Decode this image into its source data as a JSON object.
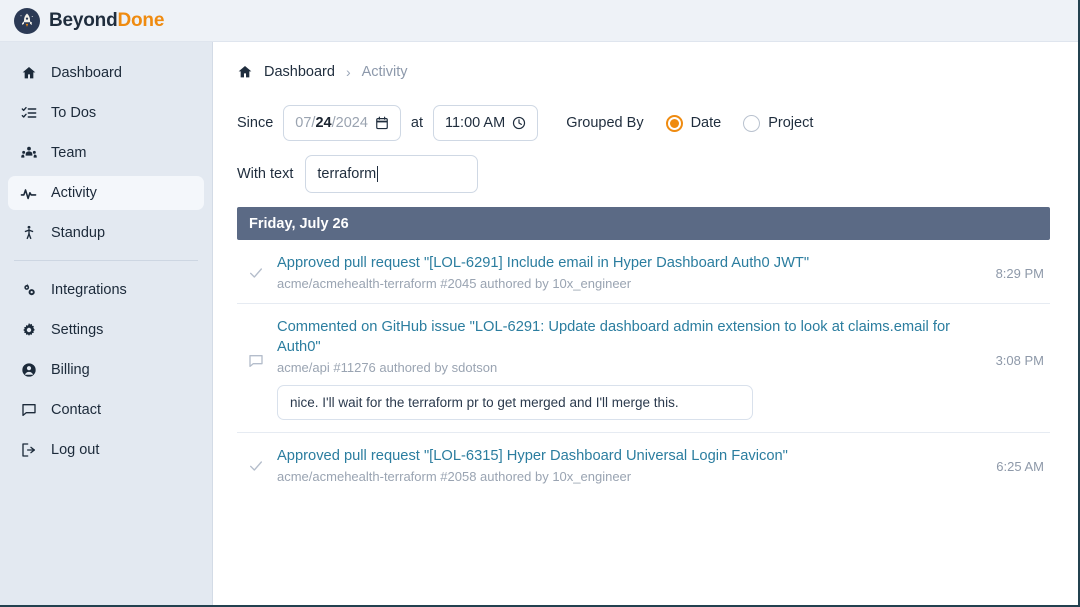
{
  "brand": {
    "name_first": "Beyond",
    "name_second": "Done",
    "logo_icon": "rocket-icon",
    "accent_color": "#ef8b10"
  },
  "sidebar": {
    "items": [
      {
        "label": "Dashboard",
        "icon": "home-icon",
        "active": false
      },
      {
        "label": "To Dos",
        "icon": "list-check-icon",
        "active": false
      },
      {
        "label": "Team",
        "icon": "users-icon",
        "active": false
      },
      {
        "label": "Activity",
        "icon": "pulse-icon",
        "active": true
      },
      {
        "label": "Standup",
        "icon": "person-running-icon",
        "active": false
      }
    ],
    "items_secondary": [
      {
        "label": "Integrations",
        "icon": "gears-icon",
        "active": false
      },
      {
        "label": "Settings",
        "icon": "gear-icon",
        "active": false
      },
      {
        "label": "Billing",
        "icon": "user-circle-icon",
        "active": false
      },
      {
        "label": "Contact",
        "icon": "comment-icon",
        "active": false
      },
      {
        "label": "Log out",
        "icon": "sign-out-icon",
        "active": false
      }
    ]
  },
  "breadcrumb": {
    "home_icon": "home-icon",
    "parent": "Dashboard",
    "separator": "›",
    "current": "Activity"
  },
  "filters": {
    "since_label": "Since",
    "date_value": "07/24/2024",
    "date_parts": {
      "month": "07",
      "day": "24",
      "year": "2024"
    },
    "date_icon": "calendar-icon",
    "at_label": "at",
    "time_value": "11:00 AM",
    "time_icon": "clock-icon",
    "grouped_by_label": "Grouped By",
    "radios": [
      {
        "label": "Date",
        "selected": true
      },
      {
        "label": "Project",
        "selected": false
      }
    ],
    "with_text_label": "With text",
    "with_text_value": "terraform"
  },
  "activity": {
    "group_header": "Friday, July 26",
    "rows": [
      {
        "icon": "check-icon",
        "title": "Approved pull request \"[LOL-6291] Include email in Hyper Dashboard Auth0 JWT\"",
        "meta": "acme/acmehealth-terraform #2045 authored by 10x_engineer",
        "time": "8:29 PM",
        "quote": null
      },
      {
        "icon": "comment-icon",
        "title": "Commented on GitHub issue \"LOL-6291: Update dashboard admin extension to look at claims.email for Auth0\"",
        "meta": "acme/api #11276 authored by sdotson",
        "time": "3:08 PM",
        "quote": "nice. I'll wait for the terraform pr to get merged and I'll merge this."
      },
      {
        "icon": "check-icon",
        "title": "Approved pull request \"[LOL-6315] Hyper Dashboard Universal Login Favicon\"",
        "meta": "acme/acmehealth-terraform #2058 authored by 10x_engineer",
        "time": "6:25 AM",
        "quote": null
      }
    ]
  },
  "colors": {
    "accent": "#ef8b10",
    "link": "#2b7d9f",
    "group_header_bg": "#5b6a85",
    "sidebar_bg": "#e3e9f1",
    "topbar_bg": "#eef2f7"
  }
}
